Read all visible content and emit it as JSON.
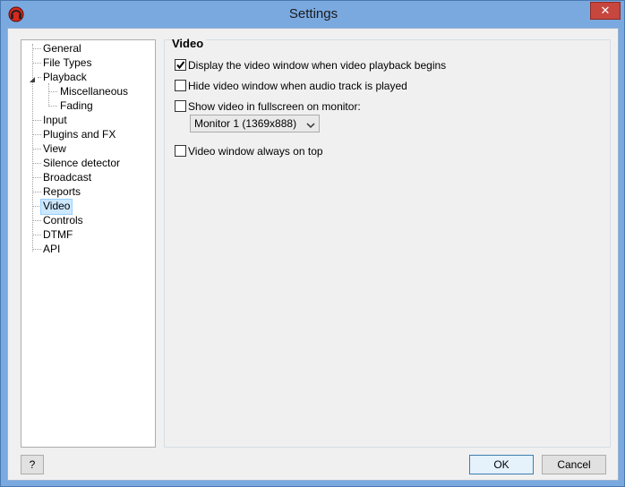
{
  "window": {
    "title": "Settings",
    "close_label": "✕",
    "app_icon": "headphones-icon",
    "titlebar_color": "#7aa9e0",
    "close_color": "#c7463e"
  },
  "tree": {
    "items": [
      {
        "label": "General"
      },
      {
        "label": "File Types"
      },
      {
        "label": "Playback"
      },
      {
        "label": "Miscellaneous"
      },
      {
        "label": "Fading"
      },
      {
        "label": "Input"
      },
      {
        "label": "Plugins and FX"
      },
      {
        "label": "View"
      },
      {
        "label": "Silence detector"
      },
      {
        "label": "Broadcast"
      },
      {
        "label": "Reports"
      },
      {
        "label": "Video",
        "selected": true
      },
      {
        "label": "Controls"
      },
      {
        "label": "DTMF"
      },
      {
        "label": "API"
      }
    ],
    "selected_color": "#cce8ff"
  },
  "panel": {
    "title": "Video",
    "options": [
      {
        "label": "Display the video window when video playback begins",
        "checked": true
      },
      {
        "label": "Hide video window when audio track is played",
        "checked": false
      },
      {
        "label": "Show video in fullscreen on monitor:",
        "checked": false
      },
      {
        "label": "Video window always on top",
        "checked": false
      }
    ],
    "monitor_select": {
      "value": "Monitor 1 (1369x888)"
    }
  },
  "buttons": {
    "help": "?",
    "ok": "OK",
    "cancel": "Cancel"
  }
}
